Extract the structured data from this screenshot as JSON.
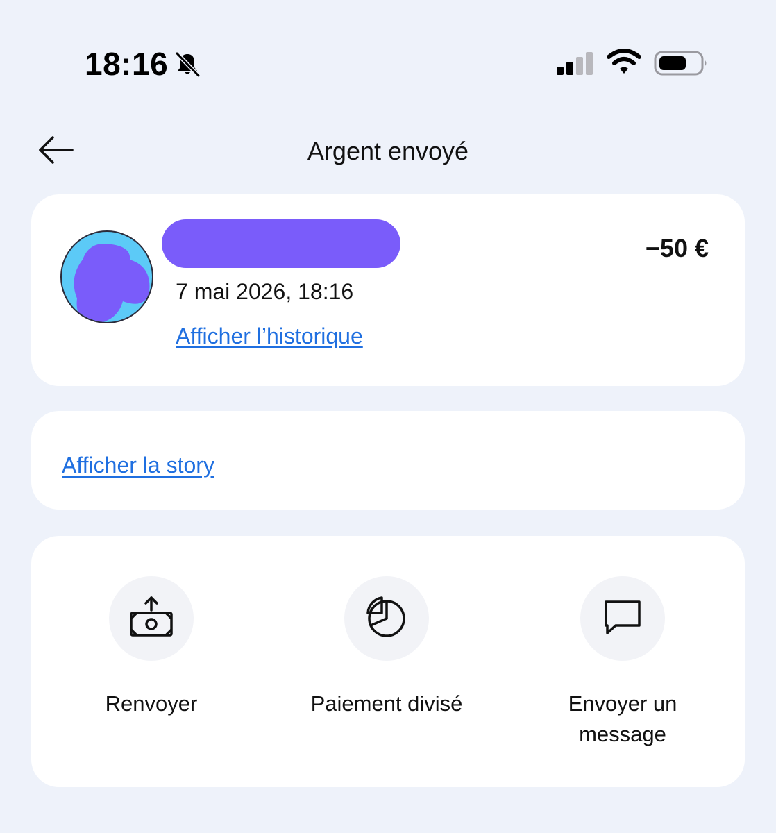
{
  "status_bar": {
    "time": "18:16",
    "icons": [
      "bell-off-icon",
      "cellular-signal-icon",
      "wifi-icon",
      "battery-icon"
    ]
  },
  "header": {
    "back_icon": "arrow-left-icon",
    "title": "Argent envoyé"
  },
  "transaction": {
    "recipient_name": "",
    "date": "7 mai 2026, 18:16",
    "history_link": "Afficher l’historique",
    "amount": "−50 €"
  },
  "story": {
    "link": "Afficher la story"
  },
  "actions": [
    {
      "label": "Renvoyer",
      "icon": "send-money-icon"
    },
    {
      "label": "Paiement divisé",
      "icon": "pie-chart-icon"
    },
    {
      "label": "Envoyer un message",
      "icon": "chat-bubble-icon"
    }
  ],
  "colors": {
    "background": "#eef2fa",
    "card": "#ffffff",
    "link": "#1f6fe0",
    "redaction": "#7a5cfa",
    "avatar_bg": "#5ccaf7"
  }
}
